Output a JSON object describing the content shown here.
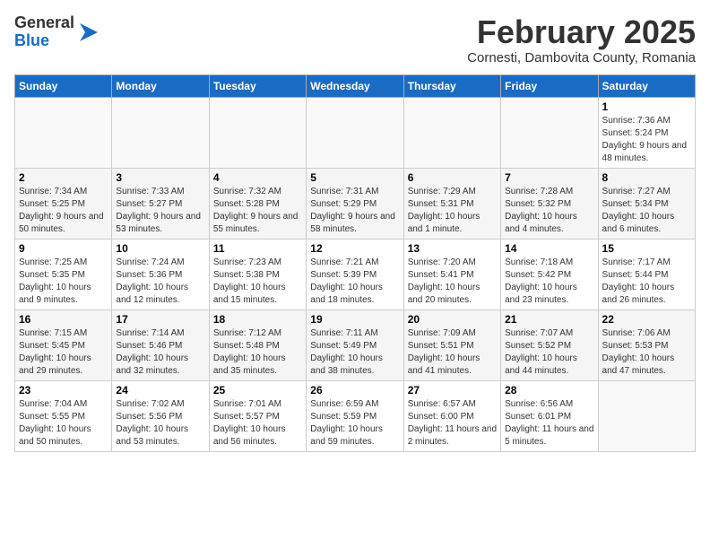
{
  "header": {
    "logo_general": "General",
    "logo_blue": "Blue",
    "title": "February 2025",
    "subtitle": "Cornesti, Dambovita County, Romania"
  },
  "weekdays": [
    "Sunday",
    "Monday",
    "Tuesday",
    "Wednesday",
    "Thursday",
    "Friday",
    "Saturday"
  ],
  "weeks": [
    [
      {
        "day": "",
        "info": ""
      },
      {
        "day": "",
        "info": ""
      },
      {
        "day": "",
        "info": ""
      },
      {
        "day": "",
        "info": ""
      },
      {
        "day": "",
        "info": ""
      },
      {
        "day": "",
        "info": ""
      },
      {
        "day": "1",
        "info": "Sunrise: 7:36 AM\nSunset: 5:24 PM\nDaylight: 9 hours and 48 minutes."
      }
    ],
    [
      {
        "day": "2",
        "info": "Sunrise: 7:34 AM\nSunset: 5:25 PM\nDaylight: 9 hours and 50 minutes."
      },
      {
        "day": "3",
        "info": "Sunrise: 7:33 AM\nSunset: 5:27 PM\nDaylight: 9 hours and 53 minutes."
      },
      {
        "day": "4",
        "info": "Sunrise: 7:32 AM\nSunset: 5:28 PM\nDaylight: 9 hours and 55 minutes."
      },
      {
        "day": "5",
        "info": "Sunrise: 7:31 AM\nSunset: 5:29 PM\nDaylight: 9 hours and 58 minutes."
      },
      {
        "day": "6",
        "info": "Sunrise: 7:29 AM\nSunset: 5:31 PM\nDaylight: 10 hours and 1 minute."
      },
      {
        "day": "7",
        "info": "Sunrise: 7:28 AM\nSunset: 5:32 PM\nDaylight: 10 hours and 4 minutes."
      },
      {
        "day": "8",
        "info": "Sunrise: 7:27 AM\nSunset: 5:34 PM\nDaylight: 10 hours and 6 minutes."
      }
    ],
    [
      {
        "day": "9",
        "info": "Sunrise: 7:25 AM\nSunset: 5:35 PM\nDaylight: 10 hours and 9 minutes."
      },
      {
        "day": "10",
        "info": "Sunrise: 7:24 AM\nSunset: 5:36 PM\nDaylight: 10 hours and 12 minutes."
      },
      {
        "day": "11",
        "info": "Sunrise: 7:23 AM\nSunset: 5:38 PM\nDaylight: 10 hours and 15 minutes."
      },
      {
        "day": "12",
        "info": "Sunrise: 7:21 AM\nSunset: 5:39 PM\nDaylight: 10 hours and 18 minutes."
      },
      {
        "day": "13",
        "info": "Sunrise: 7:20 AM\nSunset: 5:41 PM\nDaylight: 10 hours and 20 minutes."
      },
      {
        "day": "14",
        "info": "Sunrise: 7:18 AM\nSunset: 5:42 PM\nDaylight: 10 hours and 23 minutes."
      },
      {
        "day": "15",
        "info": "Sunrise: 7:17 AM\nSunset: 5:44 PM\nDaylight: 10 hours and 26 minutes."
      }
    ],
    [
      {
        "day": "16",
        "info": "Sunrise: 7:15 AM\nSunset: 5:45 PM\nDaylight: 10 hours and 29 minutes."
      },
      {
        "day": "17",
        "info": "Sunrise: 7:14 AM\nSunset: 5:46 PM\nDaylight: 10 hours and 32 minutes."
      },
      {
        "day": "18",
        "info": "Sunrise: 7:12 AM\nSunset: 5:48 PM\nDaylight: 10 hours and 35 minutes."
      },
      {
        "day": "19",
        "info": "Sunrise: 7:11 AM\nSunset: 5:49 PM\nDaylight: 10 hours and 38 minutes."
      },
      {
        "day": "20",
        "info": "Sunrise: 7:09 AM\nSunset: 5:51 PM\nDaylight: 10 hours and 41 minutes."
      },
      {
        "day": "21",
        "info": "Sunrise: 7:07 AM\nSunset: 5:52 PM\nDaylight: 10 hours and 44 minutes."
      },
      {
        "day": "22",
        "info": "Sunrise: 7:06 AM\nSunset: 5:53 PM\nDaylight: 10 hours and 47 minutes."
      }
    ],
    [
      {
        "day": "23",
        "info": "Sunrise: 7:04 AM\nSunset: 5:55 PM\nDaylight: 10 hours and 50 minutes."
      },
      {
        "day": "24",
        "info": "Sunrise: 7:02 AM\nSunset: 5:56 PM\nDaylight: 10 hours and 53 minutes."
      },
      {
        "day": "25",
        "info": "Sunrise: 7:01 AM\nSunset: 5:57 PM\nDaylight: 10 hours and 56 minutes."
      },
      {
        "day": "26",
        "info": "Sunrise: 6:59 AM\nSunset: 5:59 PM\nDaylight: 10 hours and 59 minutes."
      },
      {
        "day": "27",
        "info": "Sunrise: 6:57 AM\nSunset: 6:00 PM\nDaylight: 11 hours and 2 minutes."
      },
      {
        "day": "28",
        "info": "Sunrise: 6:56 AM\nSunset: 6:01 PM\nDaylight: 11 hours and 5 minutes."
      },
      {
        "day": "",
        "info": ""
      }
    ]
  ]
}
